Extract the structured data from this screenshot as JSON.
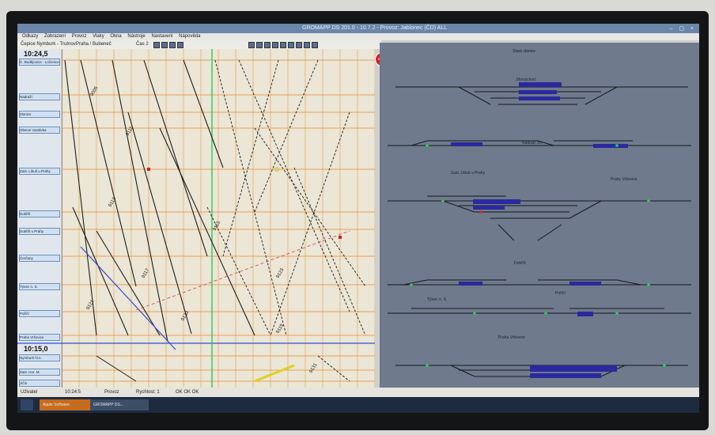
{
  "window": {
    "title": "GROMAPP DS 201.0 - 10.7.2 - Provoz: Jablonec (ČD) ALL",
    "controls": "–  ▢  ×"
  },
  "menubar": {
    "items": [
      "Odkazy",
      "Zobrazení",
      "Provoz",
      "Vlaky",
      "Okna",
      "Nástroje",
      "Nastavení",
      "Nápověda"
    ]
  },
  "toolbar": {
    "section_label": "Čepice Nymburk - Trutnov",
    "area_label": "Praha / Bubeneč",
    "page_label": "Čas 2"
  },
  "graph": {
    "top_time": "10:24,5",
    "bottom_time": "10:15,0",
    "stations": [
      "Č. Budějovice - Ločenice",
      "Nadraží",
      "Zlonice",
      "Obecní zastávka",
      "Zast. Libuš u Prahy",
      "Dobříš",
      "Dobříš u Prahy",
      "Čerčany",
      "Týnec n. S.",
      "Poříčí",
      "Praha Vršovice"
    ],
    "lower_stations": [
      "Nymburk hl.n.",
      "Zast. Hor. M.",
      "Jičín"
    ],
    "train_numbers": [
      "9005",
      "9111",
      "9113",
      "9115",
      "9117",
      "9119",
      "9121",
      "9123",
      "9131",
      "9133"
    ]
  },
  "diagram": {
    "labels": [
      "Stará stanice",
      "Jihovýchod",
      "Nádraží Jih",
      "Zast. Libuš u Prahy",
      "Prahy Vršovice",
      "Dobříš",
      "Týnec n. S.",
      "Poříčí",
      "Praha Vršovice"
    ]
  },
  "statusbar": {
    "user": "Uživatel",
    "time": "10:24:5",
    "mode": "Provoz",
    "speed": "Rychlost: 1",
    "conn": "OK  OK  OK"
  },
  "taskbar": {
    "app1": "Apple Software",
    "app2": "GROMAPP DS..."
  },
  "colors": {
    "grid": "#e28a35",
    "now_line": "#2bc65c",
    "diagram_bg": "#6f7a8c",
    "occupied": "#2a2a9e"
  }
}
